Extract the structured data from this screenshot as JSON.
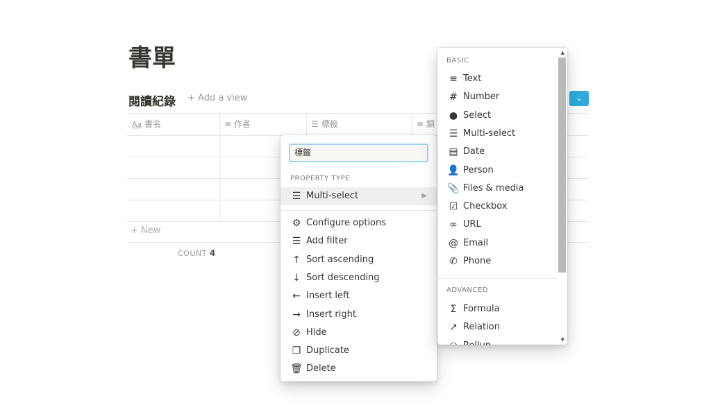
{
  "page": {
    "title": "書單"
  },
  "view": {
    "title": "閱讀紀錄",
    "add_view": "Add a view",
    "new_button_icon": "chevron-down-icon",
    "accent": "#2eaadc"
  },
  "table": {
    "columns": [
      {
        "icon": "Aa",
        "label": "書名"
      },
      {
        "icon": "≡",
        "label": "作者"
      },
      {
        "icon": "☰",
        "label": "標籤"
      },
      {
        "icon": "≡",
        "label": "類"
      }
    ],
    "rows": 4,
    "new_label": "New",
    "count_label": "COUNT",
    "count_value": "4"
  },
  "property_menu": {
    "name_value": "標籤",
    "section": "PROPERTY TYPE",
    "type": "Multi-select",
    "actions": [
      {
        "icon": "gear-icon",
        "glyph": "⚙",
        "label": "Configure options"
      },
      {
        "icon": "filter-icon",
        "glyph": "☰",
        "label": "Add filter"
      },
      {
        "icon": "arrow-up-icon",
        "glyph": "↑",
        "label": "Sort ascending"
      },
      {
        "icon": "arrow-down-icon",
        "glyph": "↓",
        "label": "Sort descending"
      },
      {
        "icon": "arrow-left-icon",
        "glyph": "←",
        "label": "Insert left"
      },
      {
        "icon": "arrow-right-icon",
        "glyph": "→",
        "label": "Insert right"
      },
      {
        "icon": "eye-slash-icon",
        "glyph": "⊘",
        "label": "Hide"
      },
      {
        "icon": "duplicate-icon",
        "glyph": "❐",
        "label": "Duplicate"
      },
      {
        "icon": "trash-icon",
        "glyph": "🗑",
        "label": "Delete"
      }
    ]
  },
  "type_menu": {
    "basic_label": "BASIC",
    "basic": [
      {
        "icon": "text-icon",
        "glyph": "≡",
        "label": "Text"
      },
      {
        "icon": "hash-icon",
        "glyph": "#",
        "label": "Number"
      },
      {
        "icon": "select-icon",
        "glyph": "●",
        "label": "Select"
      },
      {
        "icon": "list-icon",
        "glyph": "☰",
        "label": "Multi-select"
      },
      {
        "icon": "calendar-icon",
        "glyph": "▤",
        "label": "Date"
      },
      {
        "icon": "person-icon",
        "glyph": "👤",
        "label": "Person"
      },
      {
        "icon": "paperclip-icon",
        "glyph": "📎",
        "label": "Files & media"
      },
      {
        "icon": "checkbox-icon",
        "glyph": "☑",
        "label": "Checkbox"
      },
      {
        "icon": "link-icon",
        "glyph": "∞",
        "label": "URL"
      },
      {
        "icon": "at-icon",
        "glyph": "@",
        "label": "Email"
      },
      {
        "icon": "phone-icon",
        "glyph": "✆",
        "label": "Phone"
      }
    ],
    "advanced_label": "ADVANCED",
    "advanced": [
      {
        "icon": "sigma-icon",
        "glyph": "Σ",
        "label": "Formula"
      },
      {
        "icon": "arrow-ne-icon",
        "glyph": "↗",
        "label": "Relation"
      },
      {
        "icon": "search-icon",
        "glyph": "○",
        "label": "Rollup"
      }
    ]
  }
}
